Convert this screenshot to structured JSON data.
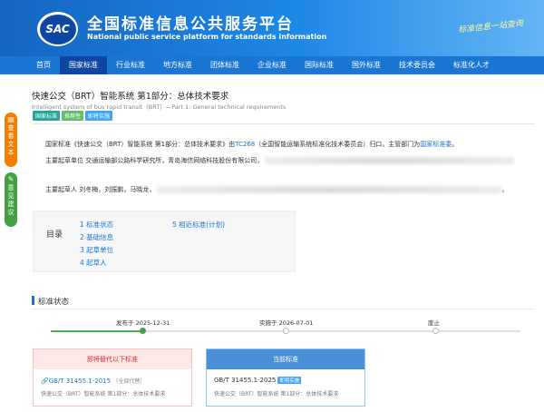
{
  "header": {
    "logo_text": "SAC",
    "title": "全国标准信息公共服务平台",
    "subtitle": "National public service platform  for standards information",
    "calligraphy": "标准信息一站查询"
  },
  "nav": {
    "items": [
      "首页",
      "国家标准",
      "行业标准",
      "地方标准",
      "团体标准",
      "企业标准",
      "国际标准",
      "国外标准",
      "技术委员会",
      "标准化人才"
    ],
    "active_index": 1
  },
  "floating": {
    "doc_text": "查看文本",
    "feedback": "意见建议"
  },
  "standard": {
    "title": "快速公交（BRT）智能系统 第1部分：总体技术要求",
    "title_en": "Intelligent system of bus rapid transit（BRT）—Part 1: General technical requirements",
    "tags": [
      "国家标准",
      "推荐性",
      "即将实施"
    ]
  },
  "info": {
    "p1_pre": "国家标准《快速公交（BRT）智能系统 第1部分：总体技术要求》由",
    "p1_tc": "TC268",
    "p1_mid": "（全国智能运输系统标准化技术委员会）归口，主管部门为",
    "p1_dept": "国家标准委",
    "p1_end": "。",
    "p2": "主要起草单位 交通运输部公路科学研究所，青岛海信网络科技股份有限公司，",
    "p3": "主要起草人 刘冬梅，刘振鹏，马晓龙，",
    "p3_end": "。"
  },
  "toc": {
    "label": "目录",
    "items": [
      "1 标准状态",
      "2 基础信息",
      "3 起草单位",
      "4 起草人",
      "5 相近标准(计划)"
    ]
  },
  "status": {
    "section_title": "标准状态",
    "timeline": [
      {
        "label": "发布于 2025-12-31",
        "done": true
      },
      {
        "label": "实施于 2026-07-01",
        "done": false
      },
      {
        "label": "废止",
        "done": false
      }
    ],
    "progress": 0.2
  },
  "cards": {
    "replaced": {
      "header": "即将替代以下标准",
      "code": "GB/T 31455.1-2015",
      "note": "（全部代替）",
      "desc": "快速公交（BRT）智能系统 第1部分：总体技术要求"
    },
    "current": {
      "header": "当前标准",
      "code": "GB/T 31455.1-2025",
      "tag": "即将实施",
      "desc": "快速公交（BRT）智能系统 第1部分：总体技术要求"
    }
  }
}
